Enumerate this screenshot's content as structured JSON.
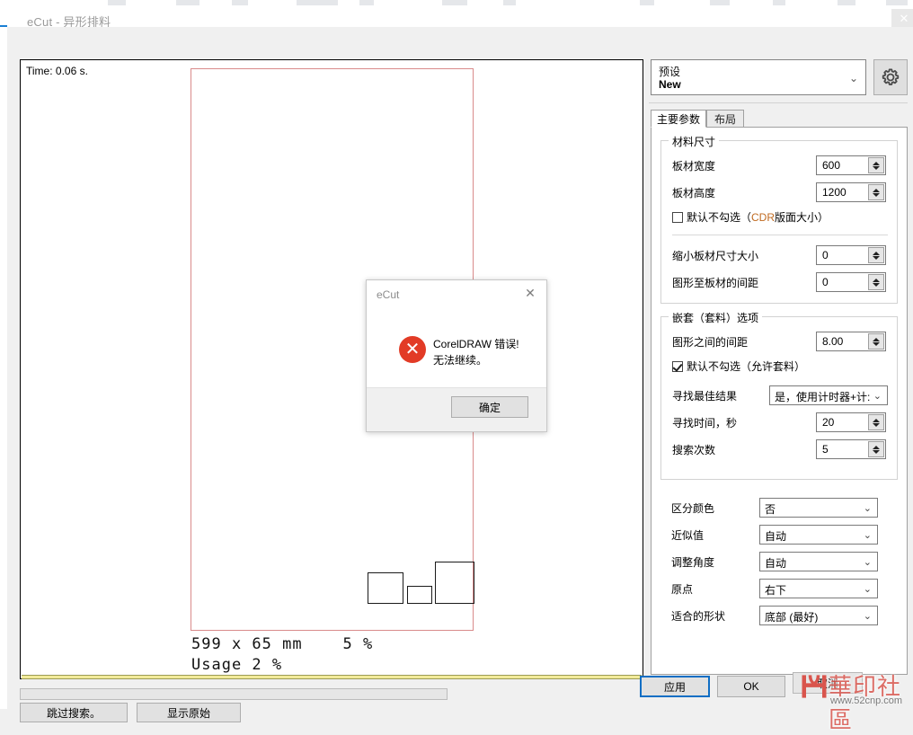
{
  "window": {
    "title": "eCut - 异形排料",
    "close_icon": "close-icon"
  },
  "canvas": {
    "time_label": "Time: 0.06 s.",
    "measurement": "599 x 65 mm    5 %",
    "usage": "Usage 2 %"
  },
  "bottom_left": {
    "skip_search_label": "跳过搜索。",
    "show_original_label": "显示原始",
    "progress_value": 0
  },
  "panel": {
    "preset": {
      "caption": "预设",
      "value": "New",
      "chevron_icon": "chevron-down-icon",
      "settings_icon": "gear-icon"
    },
    "tabs": [
      {
        "label": "主要参数",
        "active": true
      },
      {
        "label": "布局",
        "active": false
      }
    ],
    "groups": [
      {
        "title": "材料尺寸",
        "fields": [
          {
            "label": "板材宽度",
            "value": "600"
          },
          {
            "label": "板材高度",
            "value": "1200"
          }
        ],
        "checkbox": {
          "label": "默认不勾选（",
          "label_accent": "CDR",
          "label_tail": "版面大小）",
          "checked": false
        },
        "fields2": [
          {
            "label": "缩小板材尺寸大小",
            "value": "0"
          },
          {
            "label": "图形至板材的间距",
            "value": "0"
          }
        ]
      },
      {
        "title": "嵌套（套料）选项",
        "spacing": {
          "label": "图形之间的间距",
          "value": "8.00"
        },
        "checkbox": {
          "label": "默认不勾选（允许套料）",
          "checked": true
        },
        "best_result": {
          "label": "寻找最佳结果",
          "value": "是，使用计时器+计:"
        },
        "time_sec": {
          "label": "寻找时间，秒",
          "value": "20"
        },
        "search_count": {
          "label": "搜索次数",
          "value": "5"
        }
      }
    ],
    "selects": [
      {
        "label": "区分颜色",
        "value": "否"
      },
      {
        "label": "近似值",
        "value": "自动"
      },
      {
        "label": "调整角度",
        "value": "自动"
      },
      {
        "label": "原点",
        "value": "右下"
      },
      {
        "label": "适合的形状",
        "value": "底部 (最好)"
      }
    ]
  },
  "bottom_right": {
    "apply_label": "应用",
    "ok_label": "OK",
    "cancel_label": "取消"
  },
  "watermark": {
    "text": "華印社區",
    "url": "www.52cnp.com"
  },
  "dialog": {
    "title": "eCut",
    "close_icon": "close-icon",
    "error_icon": "error-x-icon",
    "message_line1": "CorelDRAW 错误!",
    "message_line2": "无法继续。",
    "ok_label": "确定"
  },
  "colors": {
    "accent": "#0f6ec4",
    "error": "#e23b26",
    "sheet_outline": "#d98a8a",
    "watermark": "#d9554d",
    "yellow_bar": "#f2eb9a"
  }
}
